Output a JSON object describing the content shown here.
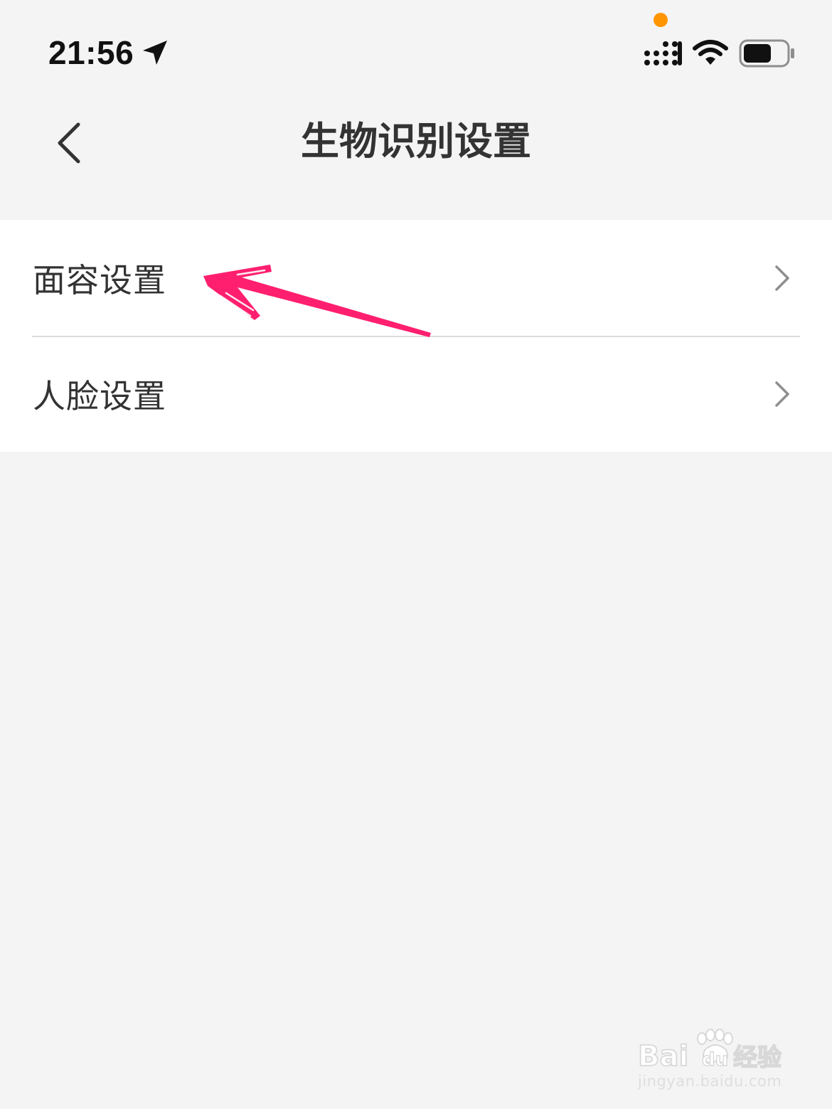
{
  "status_bar": {
    "time": "21:56",
    "icons": [
      "location-arrow-icon",
      "privacy-dot-icon",
      "cellular-signal-icon",
      "wifi-icon",
      "battery-icon"
    ],
    "privacy_dot_color": "#ff9500",
    "battery_level_percent": 65
  },
  "nav": {
    "back_icon": "chevron-left-icon",
    "title": "生物识别设置"
  },
  "settings": {
    "items": [
      {
        "label": "面容设置",
        "icon": "chevron-right-icon"
      },
      {
        "label": "人脸设置",
        "icon": "chevron-right-icon"
      }
    ]
  },
  "annotation": {
    "type": "arrow-icon",
    "color": "#ff1f6e",
    "target": "面容设置"
  },
  "watermark": {
    "logo_text": "Baidu经验",
    "url": "jingyan.baidu.com"
  },
  "colors": {
    "background": "#f4f4f4",
    "list_background": "#ffffff",
    "text": "#333333",
    "divider": "#dcdcdc",
    "chevron": "#8e8e8e"
  }
}
